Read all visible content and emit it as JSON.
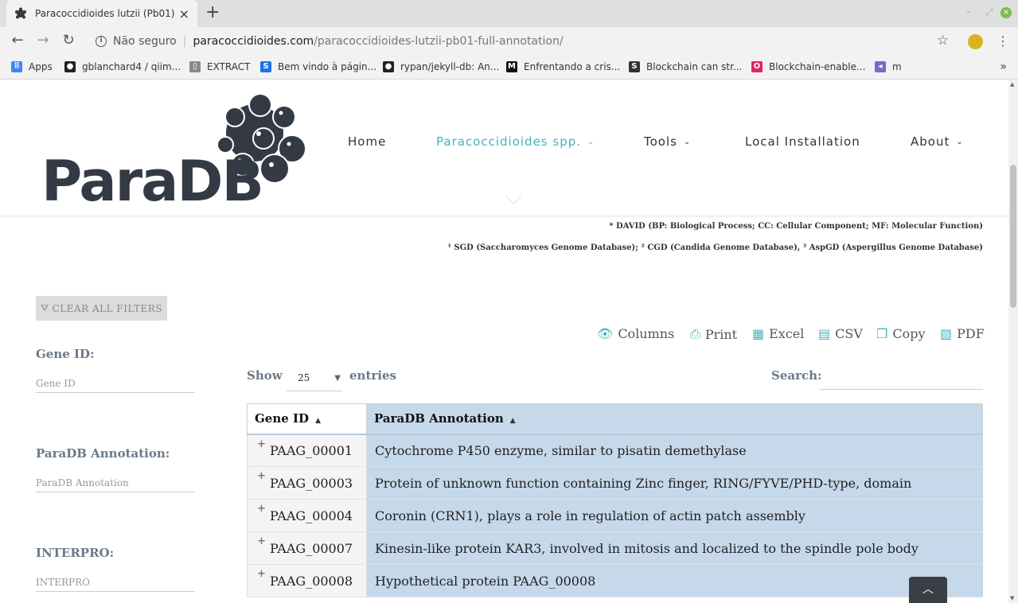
{
  "browser": {
    "tab_title": "Paracoccidioides lutzii (Pb01) –",
    "url_security": "Não seguro",
    "url_host": "paracoccidioides.com",
    "url_path": "/paracoccidioides-lutzii-pb01-full-annotation/",
    "bookmarks": [
      {
        "label": "Apps",
        "icon": "apps-grid-icon",
        "color": "#4285f4"
      },
      {
        "label": "gblanchard4 / qiim...",
        "icon": "github-icon",
        "color": "#222222"
      },
      {
        "label": "EXTRACT",
        "icon": "page-icon",
        "color": "#888888"
      },
      {
        "label": "Bem vindo à págin...",
        "icon": "s-logo-icon",
        "color": "#1a73e8"
      },
      {
        "label": "rypan/jekyll-db: An...",
        "icon": "github-icon",
        "color": "#222222"
      },
      {
        "label": "Enfrentando a cris...",
        "icon": "medium-icon",
        "color": "#111111"
      },
      {
        "label": "Blockchain can str...",
        "icon": "sd-logo-icon",
        "color": "#333333"
      },
      {
        "label": "Blockchain-enable...",
        "icon": "ring-logo-icon",
        "color": "#e0245e"
      },
      {
        "label": "m",
        "icon": "circle-logo-icon",
        "color": "#7b68c8"
      }
    ]
  },
  "site": {
    "logo_text": "ParaDB",
    "nav": [
      {
        "label": "Home",
        "has_caret": false,
        "active": false
      },
      {
        "label": "Paracoccidioides spp.",
        "has_caret": true,
        "active": true
      },
      {
        "label": "Tools",
        "has_caret": true,
        "active": false
      },
      {
        "label": "Local Installation",
        "has_caret": false,
        "active": false
      },
      {
        "label": "About",
        "has_caret": true,
        "active": false
      }
    ],
    "accent_color": "#3fb6bd"
  },
  "footnotes": {
    "line1": "* DAVID (BP: Biological Process; CC: Cellular Component; MF: Molecular Function)",
    "line2": "¹ SGD (Saccharomyces Genome Database); ² CGD (Candida Genome Database), ³ AspGD (Aspergillus Genome Database)"
  },
  "filters": {
    "clear_label": "CLEAR ALL FILTERS",
    "fields": [
      {
        "label": "Gene ID:",
        "placeholder": "Gene ID"
      },
      {
        "label": "ParaDB Annotation:",
        "placeholder": "ParaDB Annotation"
      },
      {
        "label": "INTERPRO:",
        "placeholder": "INTERPRO"
      }
    ]
  },
  "export_buttons": [
    "Columns",
    "Print",
    "Excel",
    "CSV",
    "Copy",
    "PDF"
  ],
  "table_controls": {
    "show_label": "Show",
    "length_value": "25",
    "entries_label": "entries",
    "search_label": "Search:"
  },
  "table": {
    "columns": [
      "Gene ID",
      "ParaDB Annotation"
    ],
    "rows": [
      {
        "gene_id": "PAAG_00001",
        "annotation": "Cytochrome P450 enzyme, similar to pisatin demethylase"
      },
      {
        "gene_id": "PAAG_00003",
        "annotation": "Protein of unknown function containing Zinc finger, RING/FYVE/PHD-type, domain"
      },
      {
        "gene_id": "PAAG_00004",
        "annotation": "Coronin (CRN1), plays a role in regulation of actin patch assembly"
      },
      {
        "gene_id": "PAAG_00007",
        "annotation": "Kinesin-like protein KAR3, involved in mitosis and localized to the spindle pole body"
      },
      {
        "gene_id": "PAAG_00008",
        "annotation": "Hypothetical protein PAAG_00008"
      }
    ]
  }
}
